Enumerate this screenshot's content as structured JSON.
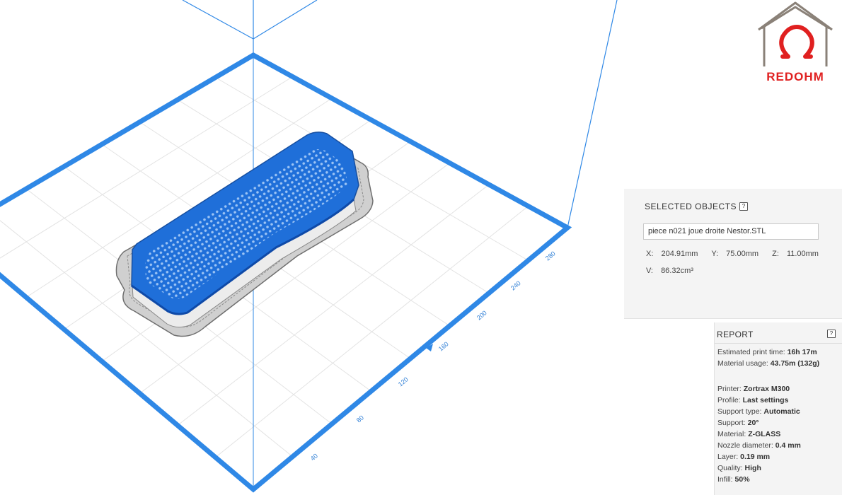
{
  "scene": {
    "axis_ticks": [
      "40",
      "80",
      "120",
      "160",
      "200",
      "240",
      "280"
    ],
    "colors": {
      "build_plate": "#2f88e6",
      "model": "#1f6fd9",
      "model_support": "#9a9a9a",
      "grid": "#e3e3e3"
    }
  },
  "logo": {
    "text": "REDOHM",
    "colors": {
      "house": "#8a8178",
      "omega": "#e02020"
    }
  },
  "selected_objects": {
    "title": "SELECTED OBJECTS",
    "help_icon": "question-icon",
    "help_label": "?",
    "file_name": "piece n021 joue droite Nestor.STL",
    "x_label": "X:",
    "x_value": "204.91mm",
    "y_label": "Y:",
    "y_value": "75.00mm",
    "z_label": "Z:",
    "z_value": "11.00mm",
    "v_label": "V:",
    "v_value": "86.32cm³"
  },
  "report": {
    "title": "REPORT",
    "help_label": "?",
    "lines": [
      {
        "label": "Estimated print time:",
        "value": "16h 17m"
      },
      {
        "label": "Material usage:",
        "value": "43.75m (132g)"
      },
      {
        "label": "Printer:",
        "value": "Zortrax M300"
      },
      {
        "label": "Profile:",
        "value": "Last settings"
      },
      {
        "label": "Support type:",
        "value": "Automatic"
      },
      {
        "label": "Support:",
        "value": "20°"
      },
      {
        "label": "Material:",
        "value": "Z-GLASS"
      },
      {
        "label": "Nozzle diameter:",
        "value": "0.4 mm"
      },
      {
        "label": "Layer:",
        "value": "0.19 mm"
      },
      {
        "label": "Quality:",
        "value": "High"
      },
      {
        "label": "Infill:",
        "value": "50%"
      }
    ]
  }
}
